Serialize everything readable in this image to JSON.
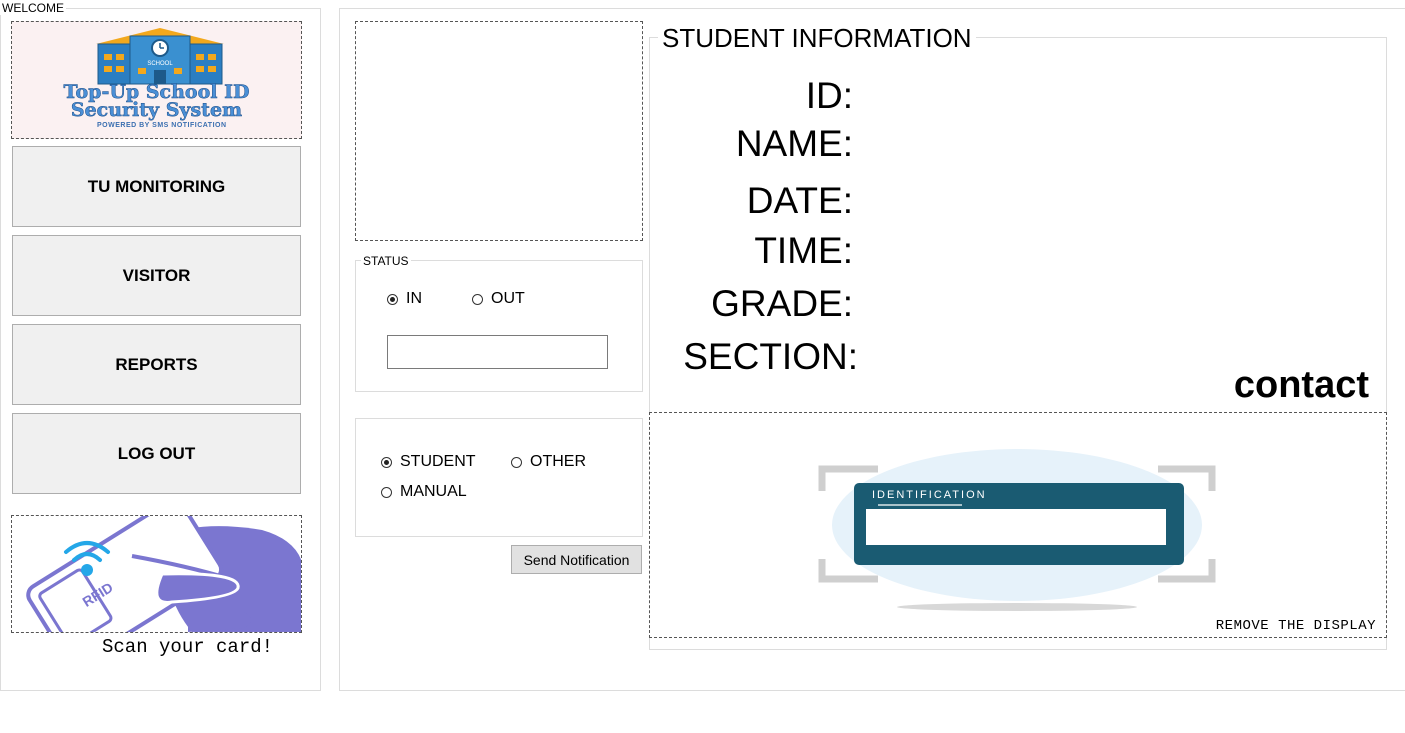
{
  "sidebar": {
    "title": "WELCOME",
    "logo": {
      "line1": "Top-Up School ID",
      "line2": "Security System",
      "tagline": "POWERED BY SMS NOTIFICATION",
      "sign": "SCHOOL"
    },
    "buttons": [
      {
        "label": "TU MONITORING"
      },
      {
        "label": "VISITOR"
      },
      {
        "label": "REPORTS"
      },
      {
        "label": "LOG OUT"
      }
    ],
    "rfid_text": "RFID",
    "scan_text": "Scan your card!"
  },
  "status": {
    "group_label": "STATUS",
    "options": [
      {
        "label": "IN",
        "selected": true
      },
      {
        "label": "OUT",
        "selected": false
      }
    ],
    "input_value": ""
  },
  "type": {
    "options": [
      {
        "label": "STUDENT",
        "selected": true
      },
      {
        "label": "OTHER",
        "selected": false
      },
      {
        "label": "MANUAL",
        "selected": false
      }
    ]
  },
  "send_button": {
    "label": "Send Notification"
  },
  "student_info": {
    "title": "STUDENT INFORMATION",
    "labels": {
      "id": "ID:",
      "name": "NAME:",
      "date": "DATE:",
      "time": "TIME:",
      "grade": "GRADE:",
      "section": "SECTION:"
    },
    "contact": "contact"
  },
  "display": {
    "card_title": "IDENTIFICATION",
    "remove_text": "REMOVE THE DISPLAY"
  },
  "colors": {
    "card": "#1a5b72",
    "hand": "#7b76d0",
    "logo_blue": "#4a8fd6",
    "building": "#2b7ec2",
    "roof": "#f2a81d"
  }
}
